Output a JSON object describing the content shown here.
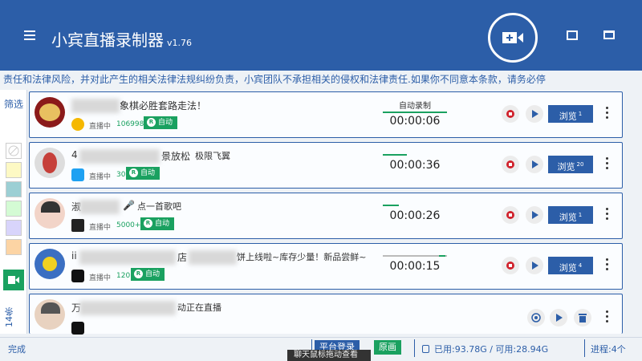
{
  "app": {
    "title": "小宾直播录制器",
    "version": "v1.76"
  },
  "marquee": "责任和法律风险，并对此产生的相关法律法规纠纷负责，小宾团队不承担相关的侵权和法律责任.如果你不同意本条款，请务必停",
  "sidebar": {
    "filter_label": "筛选",
    "count_label": "14条"
  },
  "rows": [
    {
      "name": "象棋必胜套路走法！",
      "status": "直播中",
      "viewers": "106998",
      "auto": "自动",
      "rec_label": "自动录制",
      "time": "00:00:06",
      "browse": "浏览",
      "browse_count": "1"
    },
    {
      "name": "4",
      "name2": "景放松",
      "name3": "极限飞翼",
      "status": "直播中",
      "viewers": "30",
      "auto": "自动",
      "rec_label": "",
      "time": "00:00:36",
      "browse": "浏览",
      "browse_count": "20"
    },
    {
      "name": "淑",
      "name2": "点一首歌吧",
      "status": "直播中",
      "viewers": "5000+",
      "auto": "自动",
      "rec_label": "",
      "time": "00:00:26",
      "browse": "浏览",
      "browse_count": "1"
    },
    {
      "name": "ii",
      "name2": "店",
      "name3": "饼上线啦~库存少量！新品尝鲜~",
      "status": "直播中",
      "viewers": "120",
      "auto": "自动",
      "rec_label": "",
      "time": "00:00:15",
      "browse": "浏览",
      "browse_count": "4"
    },
    {
      "name": "万",
      "name2": "动正在直播",
      "status": "",
      "viewers": "",
      "auto": "",
      "rec_label": "",
      "time": "",
      "browse": "",
      "browse_count": ""
    }
  ],
  "footer": {
    "status": "完成",
    "platform_login": "平台登录",
    "source": "原画",
    "disk": "已用:93.78G / 可用:28.94G",
    "process": "进程:4个",
    "tooltip": "聊天鼠标拖动查看"
  },
  "colors": {
    "primary": "#2c5ea8",
    "green": "#1aa160",
    "red": "#d0222c"
  }
}
